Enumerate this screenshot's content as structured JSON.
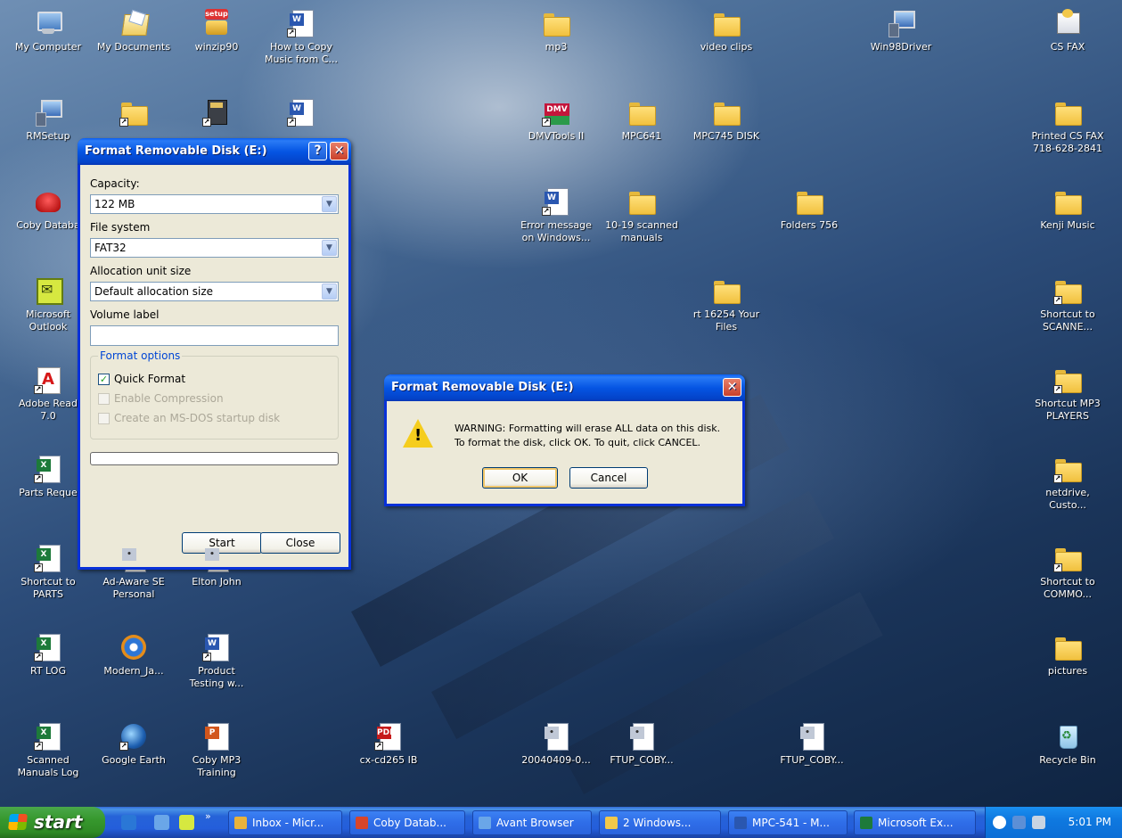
{
  "desktop": {
    "icons": [
      {
        "name": "my-computer-icon",
        "label": "My Computer",
        "kind": "pc"
      },
      {
        "name": "my-documents-icon",
        "label": "My Documents",
        "kind": "mydocs"
      },
      {
        "name": "winzip-setup-icon",
        "label": "winzip90",
        "kind": "setup"
      },
      {
        "name": "word-doc-icon",
        "label": "How to Copy\nMusic from C...",
        "kind": "word"
      },
      {
        "name": "folder-icon",
        "label": "mp3",
        "kind": "folder"
      },
      {
        "name": "folder-icon",
        "label": "video clips",
        "kind": "folder"
      },
      {
        "name": "network-setup-icon",
        "label": "Win98Driver",
        "kind": "net"
      },
      {
        "name": "fax-icon",
        "label": "CS FAX",
        "kind": "fax"
      },
      {
        "name": "network-setup-icon",
        "label": "RMSetup",
        "kind": "net"
      },
      {
        "name": "folder-shortcut-icon",
        "label": "",
        "kind": "folder"
      },
      {
        "name": "pc-tower-icon",
        "label": "",
        "kind": "pcbox"
      },
      {
        "name": "word-doc-icon",
        "label": "",
        "kind": "word"
      },
      {
        "name": "dmv-app-icon",
        "label": "DMVTools II",
        "kind": "dmv"
      },
      {
        "name": "folder-icon",
        "label": "MPC641",
        "kind": "folder"
      },
      {
        "name": "folder-icon",
        "label": "MPC745 DISK",
        "kind": "folder"
      },
      {
        "name": "folder-icon",
        "label": "Printed CS FAX\n718-628-2841",
        "kind": "folder"
      },
      {
        "name": "phone-app-icon",
        "label": "Coby Databa",
        "kind": "phone"
      },
      {
        "name": "word-doc-icon",
        "label": "Error message\non Windows...",
        "kind": "word"
      },
      {
        "name": "folder-icon",
        "label": "10-19 scanned\nmanuals",
        "kind": "folder"
      },
      {
        "name": "folder-icon",
        "label": "Folders 756",
        "kind": "folder"
      },
      {
        "name": "folder-icon",
        "label": "Kenji Music",
        "kind": "folder"
      },
      {
        "name": "outlook-icon",
        "label": "Microsoft\nOutlook",
        "kind": "outlook"
      },
      {
        "name": "folder-icon",
        "label": "rt 16254 Your\nFiles",
        "kind": "folder"
      },
      {
        "name": "folder-shortcut-icon",
        "label": "Shortcut to\nSCANNE...",
        "kind": "folder"
      },
      {
        "name": "adobe-reader-icon",
        "label": "Adobe Read\n7.0",
        "kind": "adobe"
      },
      {
        "name": "folder-shortcut-icon",
        "label": "Shortcut MP3\nPLAYERS",
        "kind": "folder"
      },
      {
        "name": "excel-doc-icon",
        "label": "Parts Reque",
        "kind": "excel"
      },
      {
        "name": "folder-shortcut-icon",
        "label": "netdrive,\nCusto...",
        "kind": "folder"
      },
      {
        "name": "excel-doc-icon",
        "label": "Shortcut to\nPARTS",
        "kind": "excel"
      },
      {
        "name": "adaware-icon",
        "label": "Ad-Aware SE\nPersonal",
        "kind": "generic"
      },
      {
        "name": "media-file-icon",
        "label": "Elton John",
        "kind": "generic"
      },
      {
        "name": "folder-shortcut-icon",
        "label": "Shortcut to\nCOMMO...",
        "kind": "folder"
      },
      {
        "name": "excel-doc-icon",
        "label": "RT LOG",
        "kind": "excel"
      },
      {
        "name": "media-player-icon",
        "label": "Modern_Ja...",
        "kind": "media"
      },
      {
        "name": "word-doc-icon",
        "label": "Product\nTesting w...",
        "kind": "word"
      },
      {
        "name": "folder-icon",
        "label": "pictures",
        "kind": "folder"
      },
      {
        "name": "excel-doc-icon",
        "label": "Scanned\nManuals Log",
        "kind": "excel"
      },
      {
        "name": "google-earth-icon",
        "label": "Google Earth",
        "kind": "earth"
      },
      {
        "name": "powerpoint-doc-icon",
        "label": "Coby MP3\nTraining",
        "kind": "ppt"
      },
      {
        "name": "pdf-doc-icon",
        "label": "cx-cd265 IB",
        "kind": "pdf"
      },
      {
        "name": "generic-file-icon",
        "label": "20040409-0...",
        "kind": "generic"
      },
      {
        "name": "generic-file-icon",
        "label": "FTUP_COBY...",
        "kind": "generic"
      },
      {
        "name": "generic-file-icon",
        "label": "FTUP_COBY...",
        "kind": "generic"
      },
      {
        "name": "recycle-bin-icon",
        "label": "Recycle Bin",
        "kind": "bin"
      }
    ]
  },
  "format_dialog": {
    "title": "Format Removable Disk (E:)",
    "help_label": "?",
    "close_label": "✕",
    "capacity_label": "Capacity:",
    "capacity_value": "122 MB",
    "fs_label": "File system",
    "fs_value": "FAT32",
    "alloc_label": "Allocation unit size",
    "alloc_value": "Default allocation size",
    "volume_label": "Volume label",
    "volume_value": "",
    "options_legend": "Format options",
    "quick_format": "Quick Format",
    "quick_format_checked": true,
    "enable_compression": "Enable Compression",
    "msdos_startup": "Create an MS-DOS startup disk",
    "progress": 0,
    "start_label": "Start",
    "close_button_label": "Close"
  },
  "warning_dialog": {
    "title": "Format Removable Disk (E:)",
    "close_label": "✕",
    "line1": "WARNING: Formatting will erase ALL data on this disk.",
    "line2": "To format the disk, click OK. To quit, click CANCEL.",
    "ok_label": "OK",
    "cancel_label": "Cancel"
  },
  "taskbar": {
    "start_label": "start",
    "overflow_label": "»",
    "tasks": [
      {
        "name": "task-inbox",
        "label": "Inbox - Micr...",
        "color": "#e8b23c"
      },
      {
        "name": "task-coby-database",
        "label": "Coby Datab...",
        "color": "#d8452b"
      },
      {
        "name": "task-avant-browser",
        "label": "Avant Browser",
        "color": "#6aa6e8"
      },
      {
        "name": "task-windows-group",
        "label": "2 Windows...",
        "color": "#f2c84b"
      },
      {
        "name": "task-mpc-541",
        "label": "MPC-541 - M...",
        "color": "#2a57b0"
      },
      {
        "name": "task-microsoft-excel",
        "label": "Microsoft Ex...",
        "color": "#1d7a3a"
      }
    ],
    "clock": "5:01 PM"
  }
}
